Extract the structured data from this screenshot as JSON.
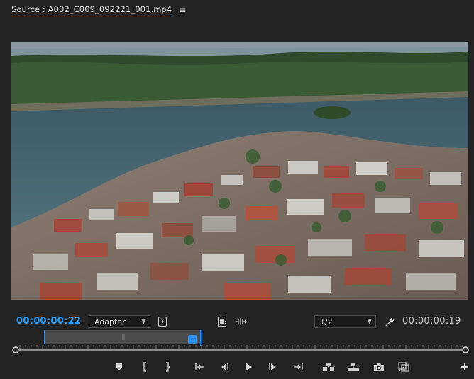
{
  "panel": {
    "title": "Source : A002_C009_092221_001.mp4",
    "menu_icon": "≡"
  },
  "viewer": {
    "content": "aerial-video-frame"
  },
  "controls": {
    "current_timecode": "00:00:00:22",
    "fit_value": "Adapter",
    "resolution_value": "1/2",
    "duration_timecode": "00:00:00:19"
  },
  "icons": {
    "panel_menu": "hamburger-icon",
    "export_frame_settings": "bracket-icon",
    "safe_margins": "film-strip-icon",
    "drag_audio_video": "waveform-icon",
    "settings": "wrench-icon",
    "marker": "marker-icon",
    "mark_in": "mark-in-icon",
    "mark_out": "mark-out-icon",
    "go_to_in": "go-to-in-icon",
    "step_back": "step-back-icon",
    "play": "play-icon",
    "step_forward": "step-forward-icon",
    "go_to_out": "go-to-out-icon",
    "insert": "insert-icon",
    "overwrite": "overwrite-icon",
    "export_frame": "camera-icon",
    "toggle_proxies": "proxy-icon",
    "add_button": "plus-icon"
  },
  "colors": {
    "accent": "#2f9bf0",
    "background": "#232323"
  }
}
